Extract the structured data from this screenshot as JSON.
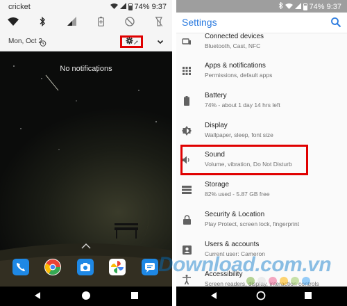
{
  "left_phone": {
    "status_bar": {
      "carrier": "cricket",
      "battery": "74%",
      "time": "9:37"
    },
    "quick_settings": {
      "tiles": [
        {
          "icon": "wifi-icon"
        },
        {
          "icon": "bluetooth-icon"
        },
        {
          "icon": "cellular-signal-icon"
        },
        {
          "icon": "battery-saver-icon"
        },
        {
          "icon": "do-not-disturb-icon"
        },
        {
          "icon": "flashlight-icon"
        }
      ],
      "date": "Mon, Oct 2",
      "settings_icon": "gear-icon",
      "expand_icon": "chevron-down-icon"
    },
    "notifications": {
      "empty_text": "No notifications"
    },
    "dock": [
      {
        "icon": "phone-icon",
        "color": "#1e88e5"
      },
      {
        "icon": "chrome-icon",
        "color": "#ea4335"
      },
      {
        "icon": "camera-icon",
        "color": "#1e88e5"
      },
      {
        "icon": "photos-icon",
        "color": "#fbbc05"
      },
      {
        "icon": "messages-icon",
        "color": "#1e88e5"
      }
    ],
    "highlight_color": "#e00000"
  },
  "right_phone": {
    "status_bar": {
      "battery": "74%",
      "time": "9:37"
    },
    "app_bar": {
      "title": "Settings",
      "search_icon": "search-icon"
    },
    "settings_items": [
      {
        "title": "Connected devices",
        "subtitle": "Bluetooth, Cast, NFC",
        "icon": "connected-devices-icon"
      },
      {
        "title": "Apps & notifications",
        "subtitle": "Permissions, default apps",
        "icon": "apps-grid-icon"
      },
      {
        "title": "Battery",
        "subtitle": "74% - about 1 day 14 hrs left",
        "icon": "battery-icon"
      },
      {
        "title": "Display",
        "subtitle": "Wallpaper, sleep, font size",
        "icon": "display-brightness-icon"
      },
      {
        "title": "Sound",
        "subtitle": "Volume, vibration, Do Not Disturb",
        "icon": "volume-icon"
      },
      {
        "title": "Storage",
        "subtitle": "82% used - 5.87 GB free",
        "icon": "storage-icon"
      },
      {
        "title": "Security & Location",
        "subtitle": "Play Protect, screen lock, fingerprint",
        "icon": "lock-icon"
      },
      {
        "title": "Users & accounts",
        "subtitle": "Current user: Cameron",
        "icon": "person-icon"
      },
      {
        "title": "Accessibility",
        "subtitle": "Screen readers, display, interaction controls",
        "icon": "accessibility-icon"
      }
    ],
    "accent_color": "#2a7adf",
    "highlight_color": "#e00000"
  },
  "watermark": {
    "text": "Download.com.vn"
  },
  "navigation": {
    "back_icon": "back-triangle-icon",
    "home_icon": "home-circle-icon",
    "recents_icon": "recents-square-icon"
  }
}
